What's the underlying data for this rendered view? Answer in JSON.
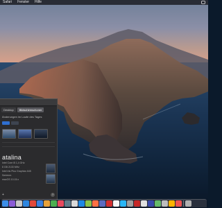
{
  "menubar": {
    "items": [
      "Safari",
      "Fenster",
      "Hilfe"
    ]
  },
  "window": {
    "tabs": [
      "Desktop",
      "Bildschirmschoner"
    ],
    "active_tab": "Bildschirmschoner",
    "subtitle": "Änderungen im Laufe des Tages",
    "os_name": "atalina",
    "info_lines": [
      "Intel Core i5 1,4 GHz",
      "8 GB 2133 MHz",
      "Intel Iris Plus Graphics 645",
      "Seriennr.",
      "macOS 10.15.x"
    ]
  },
  "dock": {
    "icons": [
      {
        "name": "finder-icon",
        "color": "#3b8ee8"
      },
      {
        "name": "siri-icon",
        "color": "#8a5cd6"
      },
      {
        "name": "launchpad-icon",
        "color": "#c7c7c7"
      },
      {
        "name": "safari-icon",
        "color": "#2d86e0"
      },
      {
        "name": "chrome-icon",
        "color": "#e2483b"
      },
      {
        "name": "mail-icon",
        "color": "#3a7fe0"
      },
      {
        "name": "app-icon-1",
        "color": "#e8a23a"
      },
      {
        "name": "app-icon-2",
        "color": "#4caf50"
      },
      {
        "name": "app-icon-3",
        "color": "#e84a5f"
      },
      {
        "name": "app-icon-4",
        "color": "#607d8b"
      },
      {
        "name": "app-icon-5",
        "color": "#d9d9d9"
      },
      {
        "name": "app-icon-6",
        "color": "#1e88e5"
      },
      {
        "name": "app-icon-7",
        "color": "#8bc34a"
      },
      {
        "name": "app-icon-8",
        "color": "#ff7043"
      },
      {
        "name": "app-icon-9",
        "color": "#5c6bc0"
      },
      {
        "name": "app-icon-10",
        "color": "#d32f2f"
      },
      {
        "name": "app-icon-11",
        "color": "#f5f5f5"
      },
      {
        "name": "app-icon-12",
        "color": "#29b6f6"
      },
      {
        "name": "app-icon-13",
        "color": "#9e9e9e"
      },
      {
        "name": "app-icon-14",
        "color": "#c62828"
      },
      {
        "name": "app-icon-15",
        "color": "#e0e0e0"
      },
      {
        "name": "app-icon-16",
        "color": "#3949ab"
      },
      {
        "name": "app-icon-17",
        "color": "#66bb6a"
      },
      {
        "name": "app-icon-18",
        "color": "#bdbdbd"
      },
      {
        "name": "app-icon-19",
        "color": "#ffb300"
      },
      {
        "name": "app-icon-20",
        "color": "#ef5350"
      },
      {
        "name": "trash-icon",
        "color": "#b0b0b0"
      }
    ]
  }
}
